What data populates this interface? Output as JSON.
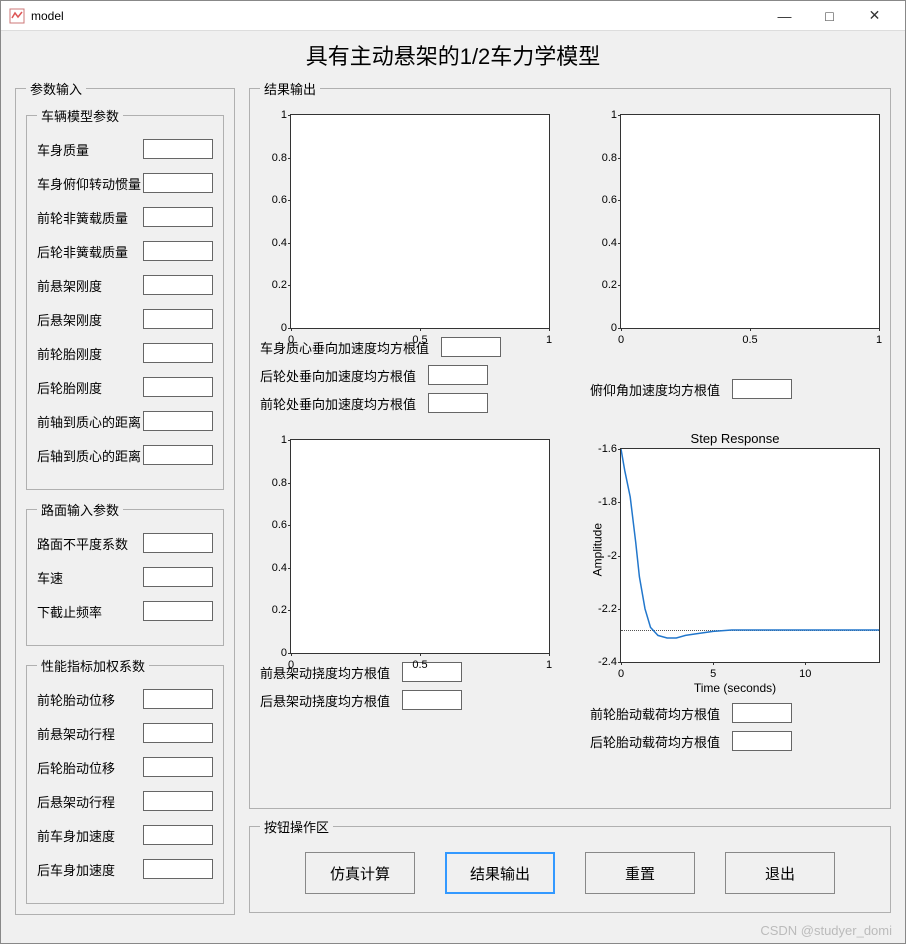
{
  "window": {
    "title": "model"
  },
  "main_title": "具有主动悬架的1/2车力学模型",
  "groups": {
    "params_input": "参数输入",
    "vehicle_params": "车辆模型参数",
    "road_params": "路面输入参数",
    "perf_coeffs": "性能指标加权系数",
    "results_output": "结果输出",
    "button_area": "按钮操作区"
  },
  "vehicle": {
    "body_mass": {
      "label": "车身质量",
      "value": ""
    },
    "pitch_inertia": {
      "label": "车身俯仰转动惯量",
      "value": ""
    },
    "front_unsprung_mass": {
      "label": "前轮非簧载质量",
      "value": ""
    },
    "rear_unsprung_mass": {
      "label": "后轮非簧载质量",
      "value": ""
    },
    "front_susp_stiff": {
      "label": "前悬架刚度",
      "value": ""
    },
    "rear_susp_stiff": {
      "label": "后悬架刚度",
      "value": ""
    },
    "front_tire_stiff": {
      "label": "前轮胎刚度",
      "value": ""
    },
    "rear_tire_stiff": {
      "label": "后轮胎刚度",
      "value": ""
    },
    "front_axle_dist": {
      "label": "前轴到质心的距离",
      "value": ""
    },
    "rear_axle_dist": {
      "label": "后轴到质心的距离",
      "value": ""
    }
  },
  "road": {
    "roughness": {
      "label": "路面不平度系数",
      "value": ""
    },
    "speed": {
      "label": "车速",
      "value": ""
    },
    "cutoff_freq": {
      "label": "下截止频率",
      "value": ""
    }
  },
  "perf": {
    "front_tire_disp": {
      "label": "前轮胎动位移",
      "value": ""
    },
    "front_susp_travel": {
      "label": "前悬架动行程",
      "value": ""
    },
    "rear_tire_disp": {
      "label": "后轮胎动位移",
      "value": ""
    },
    "rear_susp_travel": {
      "label": "后悬架动行程",
      "value": ""
    },
    "front_body_acc": {
      "label": "前车身加速度",
      "value": ""
    },
    "rear_body_acc": {
      "label": "后车身加速度",
      "value": ""
    }
  },
  "outputs": {
    "body_vert_acc_rms": {
      "label": "车身质心垂向加速度均方根值",
      "value": ""
    },
    "rear_vert_acc_rms": {
      "label": "后轮处垂向加速度均方根值",
      "value": ""
    },
    "front_vert_acc_rms": {
      "label": "前轮处垂向加速度均方根值",
      "value": ""
    },
    "pitch_acc_rms": {
      "label": "俯仰角加速度均方根值",
      "value": ""
    },
    "front_susp_defl_rms": {
      "label": "前悬架动挠度均方根值",
      "value": ""
    },
    "rear_susp_defl_rms": {
      "label": "后悬架动挠度均方根值",
      "value": ""
    },
    "front_tire_load_rms": {
      "label": "前轮胎动载荷均方根值",
      "value": ""
    },
    "rear_tire_load_rms": {
      "label": "后轮胎动载荷均方根值",
      "value": ""
    }
  },
  "buttons": {
    "simulate": "仿真计算",
    "output": "结果输出",
    "reset": "重置",
    "exit": "退出"
  },
  "watermark": "CSDN @studyer_domi",
  "chart_data": [
    {
      "type": "line",
      "id": "plot1",
      "title": "",
      "xlim": [
        0,
        1
      ],
      "ylim": [
        0,
        1
      ],
      "xticks": [
        0,
        0.5,
        1
      ],
      "yticks": [
        0,
        0.2,
        0.4,
        0.6,
        0.8,
        1
      ],
      "series": []
    },
    {
      "type": "line",
      "id": "plot2",
      "title": "",
      "xlim": [
        0,
        1
      ],
      "ylim": [
        0,
        1
      ],
      "xticks": [
        0,
        0.5,
        1
      ],
      "yticks": [
        0,
        0.2,
        0.4,
        0.6,
        0.8,
        1
      ],
      "series": []
    },
    {
      "type": "line",
      "id": "plot3",
      "title": "",
      "xlim": [
        0,
        1
      ],
      "ylim": [
        0,
        1
      ],
      "xticks": [
        0,
        0.5,
        1
      ],
      "yticks": [
        0,
        0.2,
        0.4,
        0.6,
        0.8,
        1
      ],
      "series": []
    },
    {
      "type": "line",
      "id": "plot4",
      "title": "Step Response",
      "xlabel": "Time (seconds)",
      "ylabel": "Amplitude",
      "xlim": [
        0,
        14
      ],
      "ylim": [
        -2.4,
        -1.6
      ],
      "xticks": [
        0,
        5,
        10
      ],
      "yticks": [
        -2.4,
        -2.2,
        -2,
        -1.8,
        -1.6
      ],
      "steady_state": -2.28,
      "series": [
        {
          "name": "step",
          "x": [
            0,
            0.2,
            0.5,
            0.8,
            1.0,
            1.3,
            1.6,
            2.0,
            2.5,
            3.0,
            3.5,
            4.0,
            5.0,
            6.0,
            8.0,
            10.0,
            14.0
          ],
          "y": [
            -1.6,
            -1.68,
            -1.78,
            -1.95,
            -2.08,
            -2.2,
            -2.27,
            -2.3,
            -2.31,
            -2.31,
            -2.3,
            -2.295,
            -2.285,
            -2.28,
            -2.28,
            -2.28,
            -2.28
          ]
        }
      ]
    }
  ]
}
